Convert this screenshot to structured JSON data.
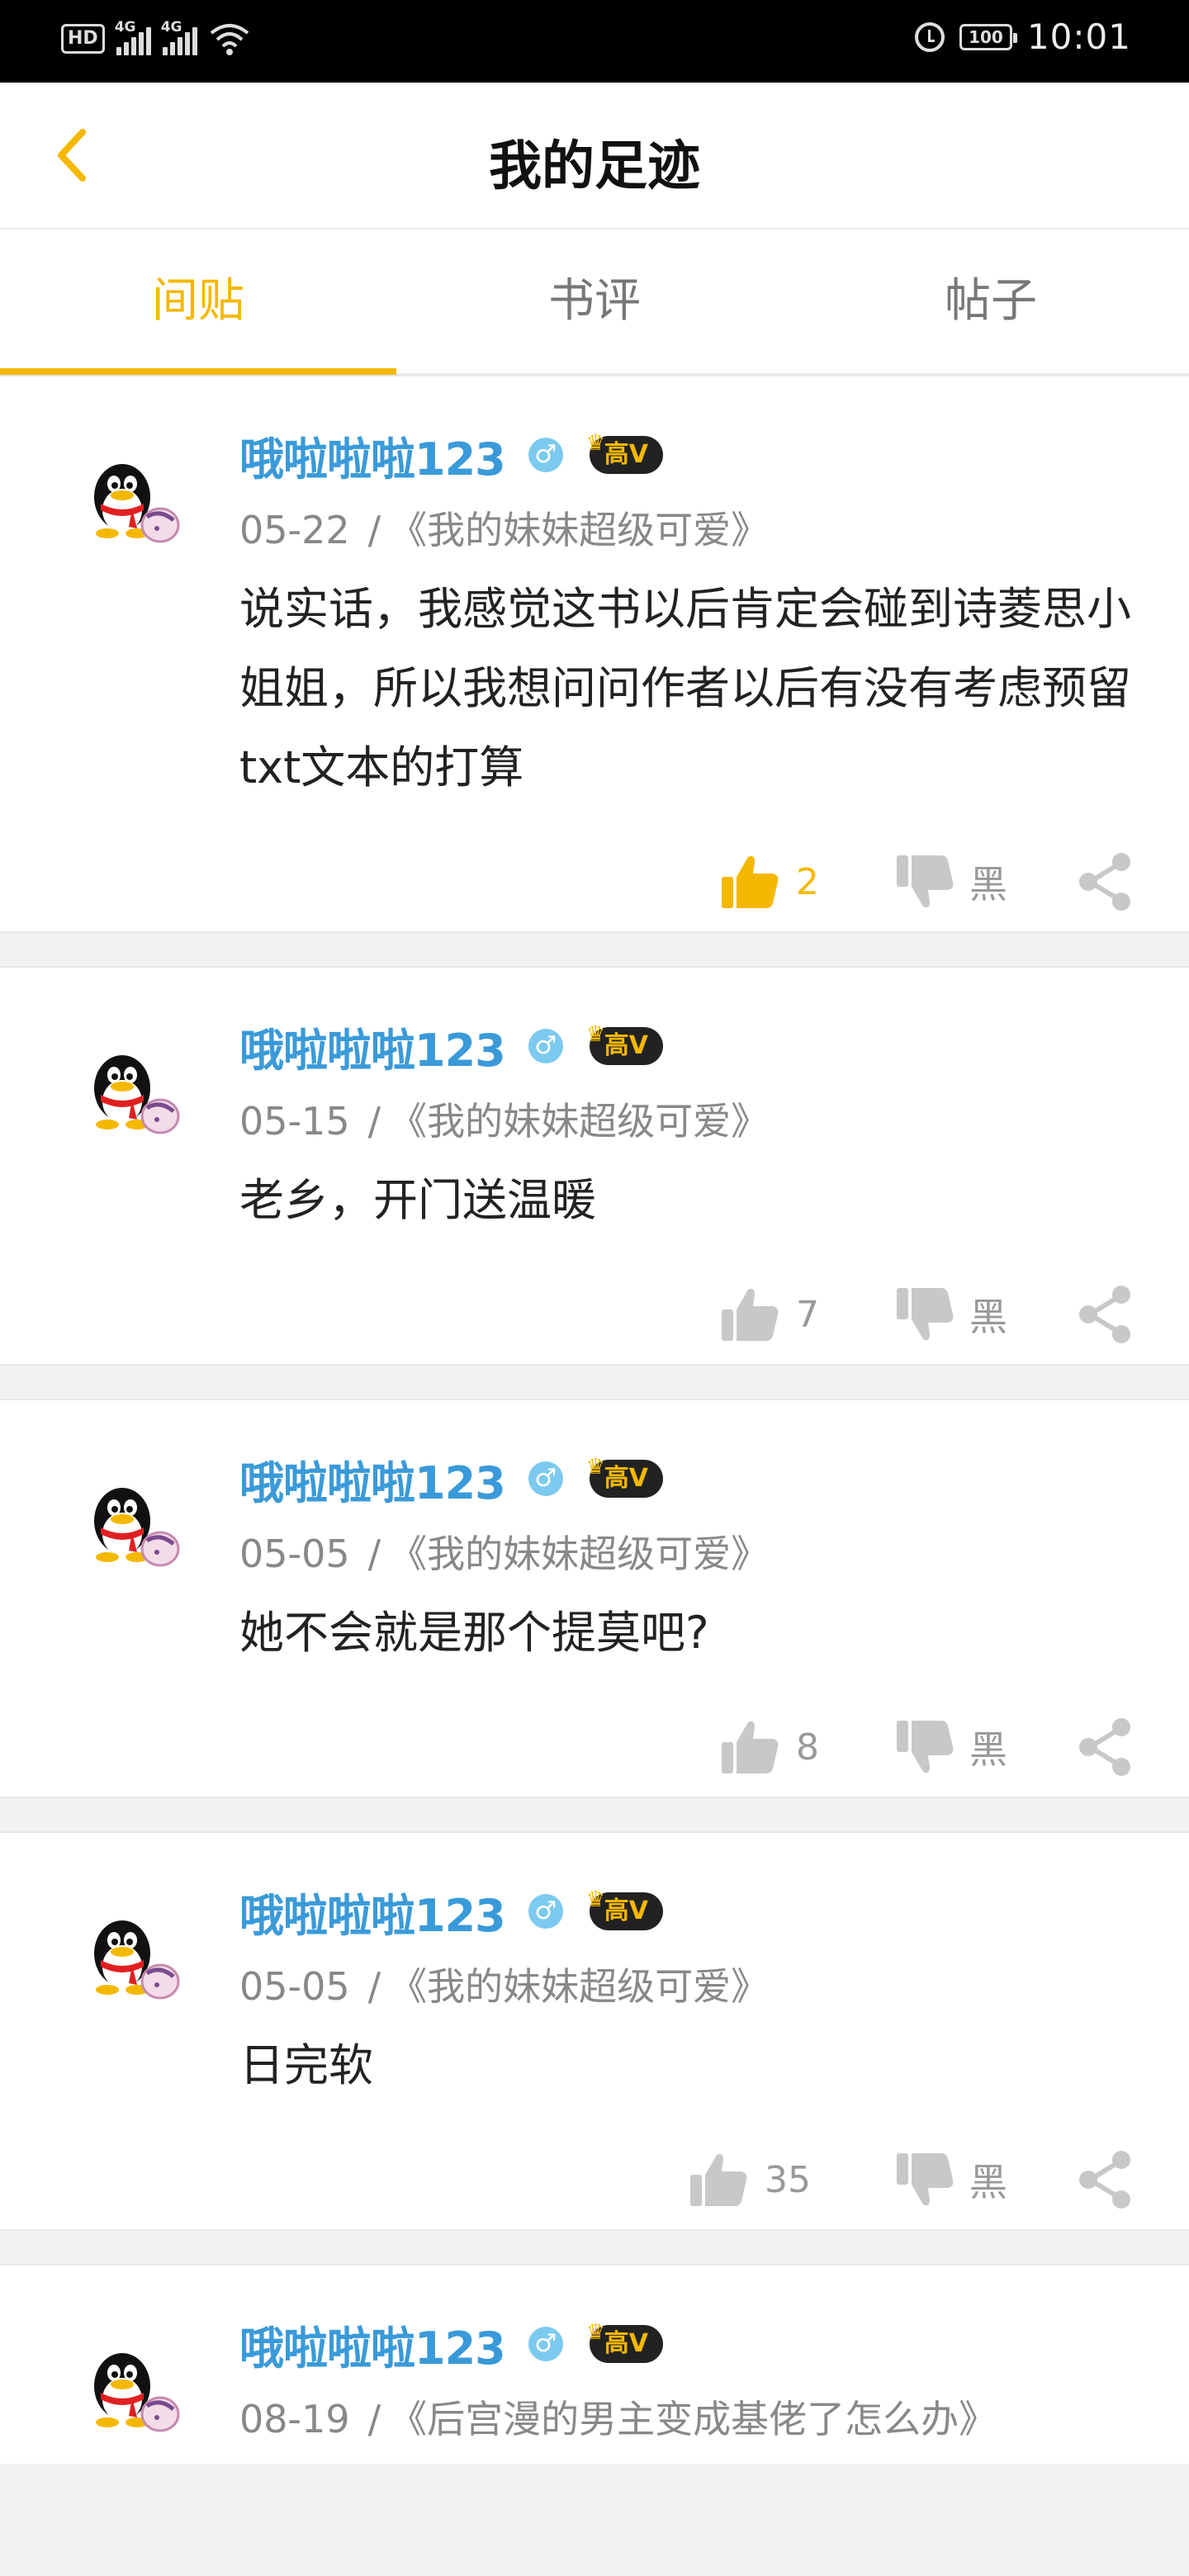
{
  "status_bar": {
    "hd": "HD",
    "net1": "4G",
    "net2": "4G",
    "battery": "100",
    "time": "10:01"
  },
  "header": {
    "title": "我的足迹"
  },
  "tabs": [
    {
      "label": "间贴",
      "active": true
    },
    {
      "label": "书评",
      "active": false
    },
    {
      "label": "帖子",
      "active": false
    }
  ],
  "posts": [
    {
      "username": "哦啦啦啦123",
      "gender": "♂",
      "badge": "高V",
      "date": "05-22",
      "book": "《我的妹妹超级可爱》",
      "content": "说实话，我感觉这书以后肯定会碰到诗菱思小姐姐，所以我想问问作者以后有没有考虑预留txt文本的打算",
      "likes": "2",
      "liked": true,
      "dislike_label": "黑"
    },
    {
      "username": "哦啦啦啦123",
      "gender": "♂",
      "badge": "高V",
      "date": "05-15",
      "book": "《我的妹妹超级可爱》",
      "content": "老乡，开门送温暖",
      "likes": "7",
      "liked": false,
      "dislike_label": "黑"
    },
    {
      "username": "哦啦啦啦123",
      "gender": "♂",
      "badge": "高V",
      "date": "05-05",
      "book": "《我的妹妹超级可爱》",
      "content": "她不会就是那个提莫吧?",
      "likes": "8",
      "liked": false,
      "dislike_label": "黑"
    },
    {
      "username": "哦啦啦啦123",
      "gender": "♂",
      "badge": "高V",
      "date": "05-05",
      "book": "《我的妹妹超级可爱》",
      "content": "日完软",
      "likes": "35",
      "liked": false,
      "dislike_label": "黑"
    },
    {
      "username": "哦啦啦啦123",
      "gender": "♂",
      "badge": "高V",
      "date": "08-19",
      "book": "《后宫漫的男主变成基佬了怎么办》",
      "content": "",
      "likes": "",
      "liked": false,
      "dislike_label": ""
    }
  ],
  "colors": {
    "accent": "#f5b800",
    "username": "#3a9ad9"
  }
}
